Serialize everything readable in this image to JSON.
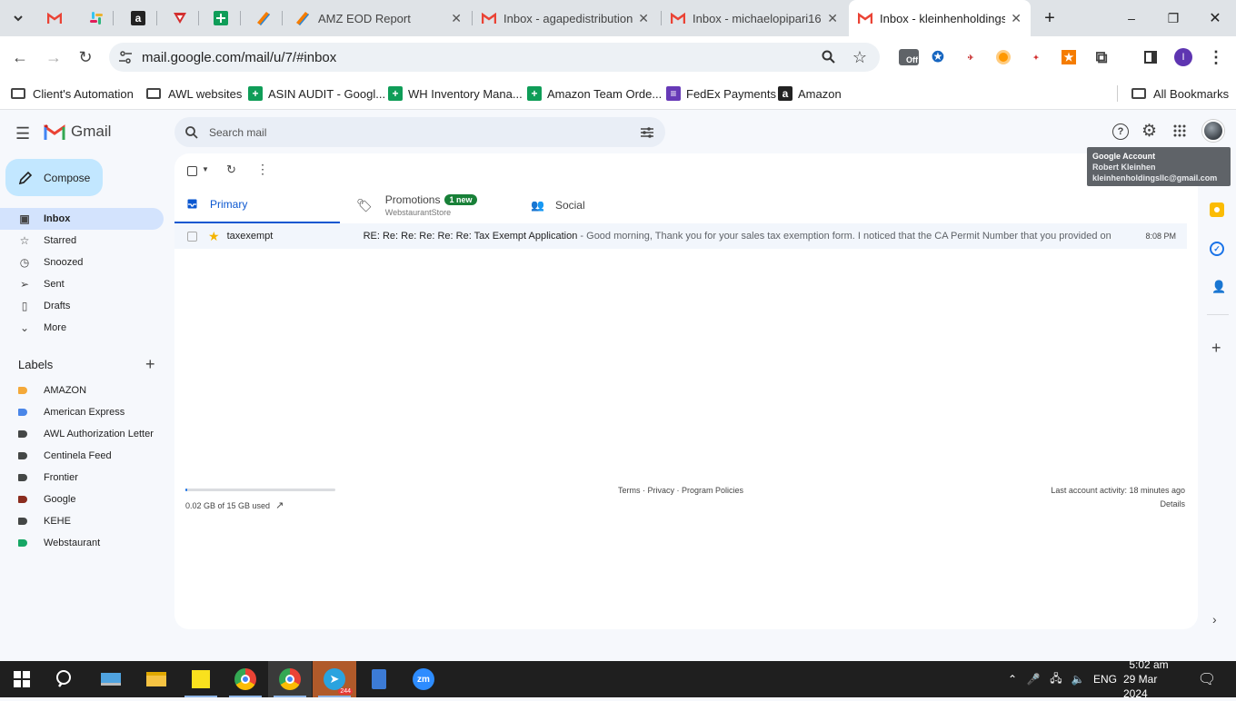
{
  "tabs": [
    {
      "title": "AMZ EOD Report"
    },
    {
      "title": "Inbox - agapedistribution"
    },
    {
      "title": "Inbox - michaelopipari16"
    },
    {
      "title": "Inbox - kleinhenholdingsll"
    }
  ],
  "url": "mail.google.com/mail/u/7/#inbox",
  "bookmarks": [
    {
      "label": "Client's Automation"
    },
    {
      "label": "AWL websites"
    },
    {
      "label": "ASIN AUDIT - Googl..."
    },
    {
      "label": "WH Inventory Mana..."
    },
    {
      "label": "Amazon Team Orde..."
    },
    {
      "label": "FedEx Payments"
    },
    {
      "label": "Amazon"
    },
    {
      "label": "All Bookmarks"
    }
  ],
  "extension_badge": "Off",
  "profile_initial": "I",
  "gmail": {
    "brand": "Gmail",
    "search_placeholder": "Search mail",
    "compose": "Compose",
    "nav": [
      {
        "label": "Inbox",
        "icon": "inbox-icon"
      },
      {
        "label": "Starred",
        "icon": "star-icon"
      },
      {
        "label": "Snoozed",
        "icon": "clock-icon"
      },
      {
        "label": "Sent",
        "icon": "send-icon"
      },
      {
        "label": "Drafts",
        "icon": "draft-icon"
      },
      {
        "label": "More",
        "icon": "chevron-down-icon"
      }
    ],
    "labels_heading": "Labels",
    "labels": [
      {
        "label": "AMAZON",
        "color": "#f4a93a"
      },
      {
        "label": "American Express",
        "color": "#4a86e8"
      },
      {
        "label": "AWL Authorization Letter",
        "color": "#444746"
      },
      {
        "label": "Centinela Feed",
        "color": "#444746"
      },
      {
        "label": "Frontier",
        "color": "#444746"
      },
      {
        "label": "Google",
        "color": "#8b2d1f"
      },
      {
        "label": "KEHE",
        "color": "#444746"
      },
      {
        "label": "Webstaurant",
        "color": "#16a765"
      }
    ],
    "categories": {
      "primary": "Primary",
      "promotions": "Promotions",
      "promotions_badge": "1 new",
      "promotions_sub": "WebstaurantStore",
      "social": "Social"
    },
    "email": {
      "sender": "taxexempt",
      "subject": "RE: Re: Re: Re: Re: Re: Tax Exempt Application",
      "snippet": " - Good morning, Thank you for your sales tax exemption form. I noticed that the CA Permit Number that you provided on the f...",
      "time": "8:08 PM"
    },
    "storage": "0.02 GB of 15 GB used",
    "storage_fraction": 0.0013,
    "footer_links": "Terms · Privacy · Program Policies",
    "last_activity": "Last account activity: 18 minutes ago",
    "details": "Details",
    "tooltip": {
      "title": "Google Account",
      "name": "Robert Kleinhen",
      "email": "kleinhenholdingsllc@gmail.com"
    }
  },
  "taskbar": {
    "telegram_badge": "244",
    "lang": "ENG",
    "time": "5:02 am",
    "date": "29 Mar 2024"
  }
}
